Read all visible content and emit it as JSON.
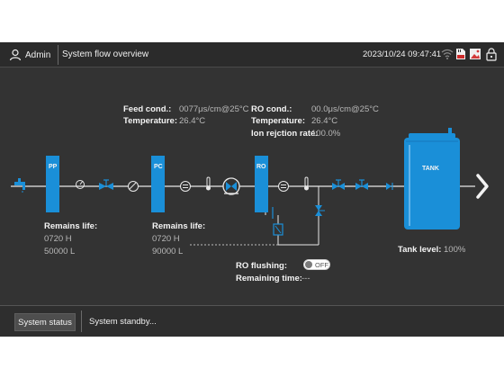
{
  "header": {
    "user_label": "Admin",
    "title": "System flow overview",
    "datetime": "2023/10/24 09:47:41",
    "icons": [
      "user-icon",
      "wifi-icon",
      "sd-card-icon",
      "image-icon",
      "lock-icon"
    ]
  },
  "feed": {
    "cond_label": "Feed cond.:",
    "cond_value": "0077μs/cm@25°C",
    "temp_label": "Temperature:",
    "temp_value": "26.4°C"
  },
  "ro": {
    "cond_label": "RO cond.:",
    "cond_value": "00.0μs/cm@25°C",
    "temp_label": "Temperature:",
    "temp_value": "26.4°C",
    "rejection_label": "Ion rejction rate:",
    "rejection_value": "100.0%"
  },
  "filters": {
    "pp": {
      "label": "PP",
      "remains_label": "Remains life:",
      "hours": "0720 H",
      "liters": "50000 L"
    },
    "pc": {
      "label": "PC",
      "remains_label": "Remains life:",
      "hours": "0720 H",
      "liters": "90000 L"
    },
    "ro": {
      "label": "RO"
    }
  },
  "tank": {
    "label": "TANK",
    "level_label": "Tank level:",
    "level_value": "100%",
    "level_fraction": 1.0
  },
  "flushing": {
    "label": "RO flushing:",
    "toggle_text": "OFF",
    "remaining_label": "Remaining time:",
    "remaining_value": "---"
  },
  "footer": {
    "status_button": "System status",
    "status_text": "System standby..."
  },
  "colors": {
    "background": "#333333",
    "accent_blue": "#1a8fd8",
    "pipe_white": "#e8e8e8",
    "dashed": "#bdbdbd"
  }
}
